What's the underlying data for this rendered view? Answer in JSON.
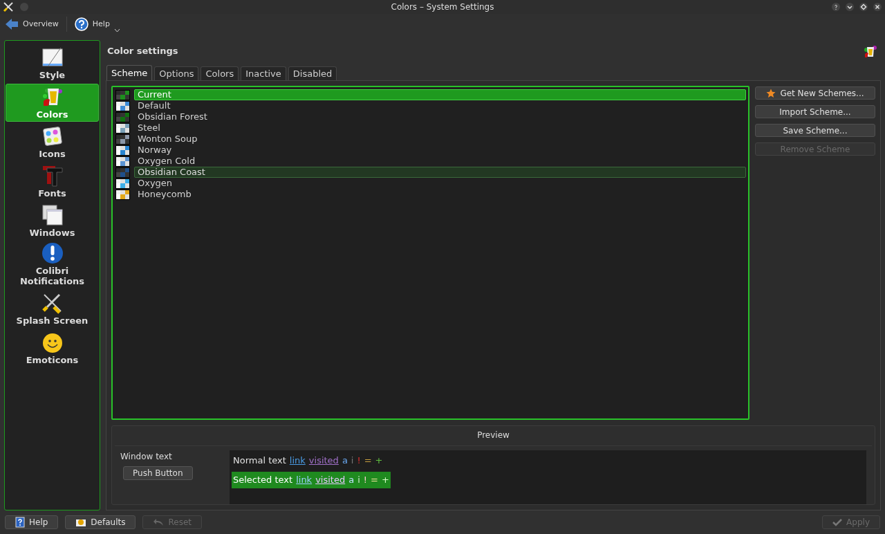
{
  "window": {
    "title": "Colors – System Settings"
  },
  "toolbar": [
    {
      "kind": "back",
      "label": "Overview"
    },
    {
      "kind": "help",
      "label": "Help",
      "dropdown": true
    }
  ],
  "sidebar": {
    "items": [
      {
        "kind": "style",
        "label": "Style",
        "selected": false
      },
      {
        "kind": "colors",
        "label": "Colors",
        "selected": true
      },
      {
        "kind": "icons",
        "label": "Icons",
        "selected": false
      },
      {
        "kind": "fonts",
        "label": "Fonts",
        "selected": false
      },
      {
        "kind": "windows",
        "label": "Windows",
        "selected": false
      },
      {
        "kind": "notifications",
        "label": "Colibri Notifications",
        "selected": false
      },
      {
        "kind": "splash",
        "label": "Splash Screen",
        "selected": false
      },
      {
        "kind": "emoticons",
        "label": "Emoticons",
        "selected": false
      }
    ]
  },
  "header": {
    "title": "Color settings"
  },
  "tabs": [
    {
      "label": "Scheme",
      "selected": true
    },
    {
      "label": "Options",
      "selected": false
    },
    {
      "label": "Colors",
      "selected": false
    },
    {
      "label": "Inactive",
      "selected": false
    },
    {
      "label": "Disabled",
      "selected": false
    }
  ],
  "schemes": [
    {
      "label": "Current",
      "color": "#1e8e1e",
      "dark": true,
      "selected": true,
      "hovered": false
    },
    {
      "label": "Default",
      "color": "#3d8ad6",
      "dark": false,
      "selected": false,
      "hovered": false
    },
    {
      "label": "Obsidian Forest",
      "color": "#117011",
      "dark": true,
      "selected": false,
      "hovered": false
    },
    {
      "label": "Steel",
      "color": "#7aa0b8",
      "dark": false,
      "selected": false,
      "hovered": false
    },
    {
      "label": "Wonton Soup",
      "color": "#8a96a8",
      "dark": true,
      "selected": false,
      "hovered": false
    },
    {
      "label": "Norway",
      "color": "#2a86d2",
      "dark": false,
      "selected": false,
      "hovered": false
    },
    {
      "label": "Oxygen Cold",
      "color": "#5b94d4",
      "dark": false,
      "selected": false,
      "hovered": false
    },
    {
      "label": "Obsidian Coast",
      "color": "#1f4f8a",
      "dark": true,
      "selected": false,
      "hovered": true
    },
    {
      "label": "Oxygen",
      "color": "#3daee9",
      "dark": false,
      "selected": false,
      "hovered": false
    },
    {
      "label": "Honeycomb",
      "color": "#e3a81a",
      "dark": false,
      "selected": false,
      "hovered": false
    }
  ],
  "scheme_buttons": [
    {
      "label": "Get New Schemes...",
      "disabled": false
    },
    {
      "label": "Import Scheme...",
      "disabled": false
    },
    {
      "label": "Save Scheme...",
      "disabled": false
    },
    {
      "label": "Remove Scheme",
      "disabled": true
    }
  ],
  "preview": {
    "title": "Preview",
    "window_text": "Window text",
    "push_button": "Push Button",
    "rows": [
      {
        "selected": false,
        "parts": [
          {
            "kind": "text",
            "text": "Normal text"
          },
          {
            "kind": "link",
            "text": "link"
          },
          {
            "kind": "visited",
            "text": "visited"
          },
          {
            "kind": "active",
            "text": "a"
          },
          {
            "kind": "inactive",
            "text": "i"
          },
          {
            "kind": "negative",
            "text": "!"
          },
          {
            "kind": "neutral",
            "text": "="
          },
          {
            "kind": "positive",
            "text": "+"
          }
        ]
      },
      {
        "selected": true,
        "parts": [
          {
            "kind": "text",
            "text": "Selected text"
          },
          {
            "kind": "link",
            "text": "link"
          },
          {
            "kind": "visited",
            "text": "visited"
          },
          {
            "kind": "active",
            "text": "a"
          },
          {
            "kind": "inactive",
            "text": "i"
          },
          {
            "kind": "negative",
            "text": "!"
          },
          {
            "kind": "neutral",
            "text": "="
          },
          {
            "kind": "positive",
            "text": "+"
          }
        ]
      }
    ]
  },
  "bottom_buttons": [
    {
      "kind": "help",
      "label": "Help",
      "disabled": false
    },
    {
      "kind": "defaults",
      "label": "Defaults",
      "disabled": false
    },
    {
      "kind": "reset",
      "label": "Reset",
      "disabled": true
    },
    {
      "kind": "apply",
      "label": "Apply",
      "disabled": true
    }
  ]
}
